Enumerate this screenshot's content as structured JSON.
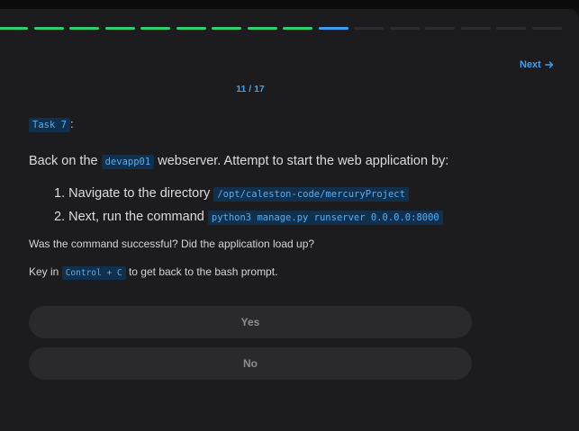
{
  "progress": {
    "segments": [
      "done",
      "done",
      "done",
      "done",
      "done",
      "done",
      "done",
      "done",
      "done",
      "current",
      "todo",
      "todo",
      "todo",
      "todo",
      "todo",
      "todo"
    ]
  },
  "nav": {
    "next_label": "Next"
  },
  "counter": "11 / 17",
  "task": {
    "label": "Task 7",
    "suffix": ":"
  },
  "intro": {
    "before": "Back on the",
    "host": "devapp01",
    "after": "webserver. Attempt to start the web application by:"
  },
  "steps": [
    {
      "number": "1.",
      "text": "Navigate to the directory",
      "code": "/opt/caleston-code/mercuryProject"
    },
    {
      "number": "2.",
      "text": "Next, run the command",
      "code": "python3 manage.py runserver 0.0.0.0:8000"
    }
  ],
  "question": "Was the command successful? Did the application load up?",
  "keyin": {
    "before": "Key in",
    "code": "Control + C",
    "after": "to get back to the bash prompt."
  },
  "options": {
    "yes": "Yes",
    "no": "No"
  },
  "colors": {
    "done": "#2dcf72",
    "current": "#3f9ef2",
    "todo": "#2c2c2f",
    "accent": "#3ea0f0"
  }
}
